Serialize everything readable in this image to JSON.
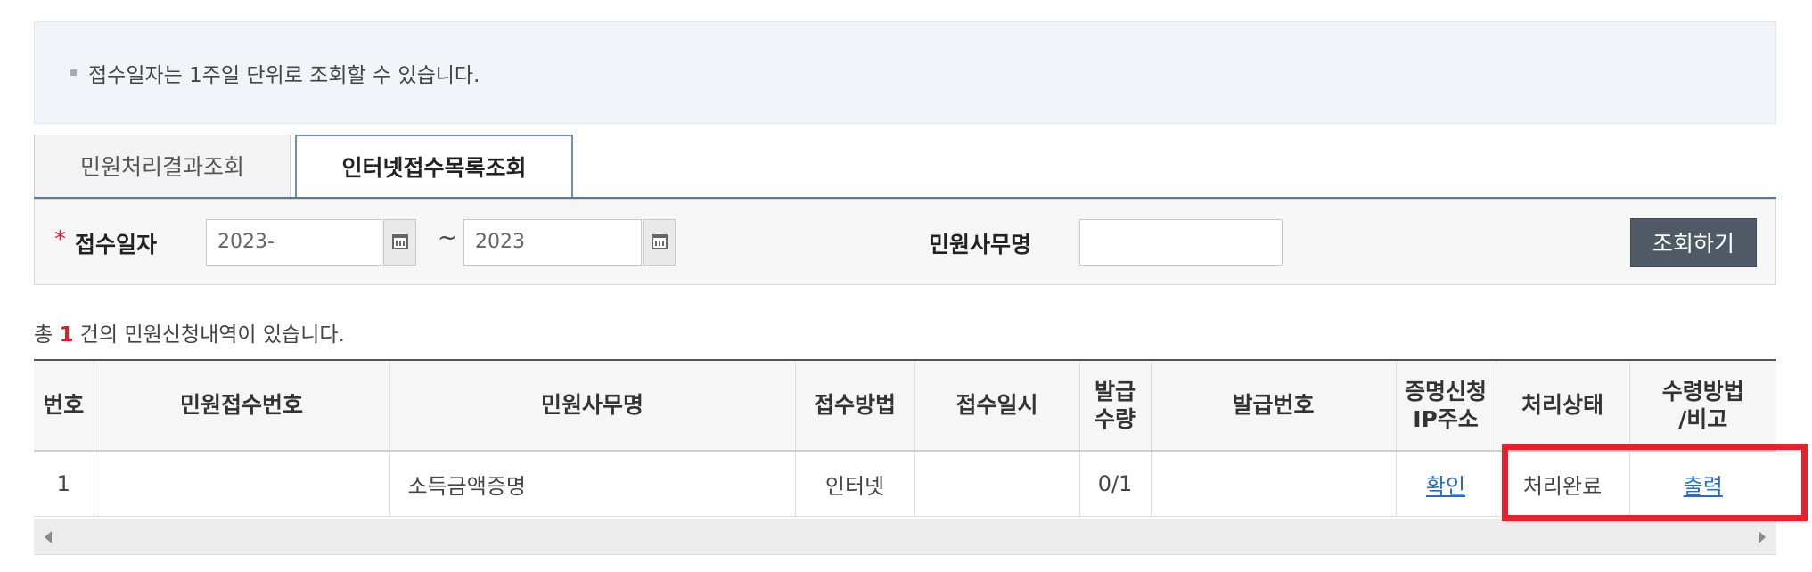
{
  "notice": {
    "text": "접수일자는 1주일 단위로 조회할 수 있습니다."
  },
  "tabs": [
    {
      "label": "민원처리결과조회",
      "active": false
    },
    {
      "label": "인터넷접수목록조회",
      "active": true
    }
  ],
  "search": {
    "required_mark": "*",
    "date_label": "접수일자",
    "date_from": "2023-",
    "date_sep": "~",
    "date_to": "2023",
    "office_label": "민원사무명",
    "office_value": "",
    "button_label": "조회하기"
  },
  "summary": {
    "prefix": "총 ",
    "count": "1",
    "suffix": " 건의 민원신청내역이 있습니다."
  },
  "table": {
    "headers": [
      "번호",
      "민원접수번호",
      "민원사무명",
      "접수방법",
      "접수일시",
      "발급\n수량",
      "발급번호",
      "증명신청\nIP주소",
      "처리상태",
      "수령방법\n/비고"
    ],
    "rows": [
      {
        "no": "1",
        "receipt_no": "",
        "office_name": "소득금액증명",
        "method": "인터넷",
        "datetime": "",
        "qty": "0/1",
        "issue_no": "",
        "ip": "확인",
        "status": "처리완료",
        "receive": "출력"
      }
    ]
  },
  "colors": {
    "highlight": "#e8202a",
    "accent": "#d5212b",
    "link": "#2a6ebb",
    "button": "#4f5a66"
  }
}
